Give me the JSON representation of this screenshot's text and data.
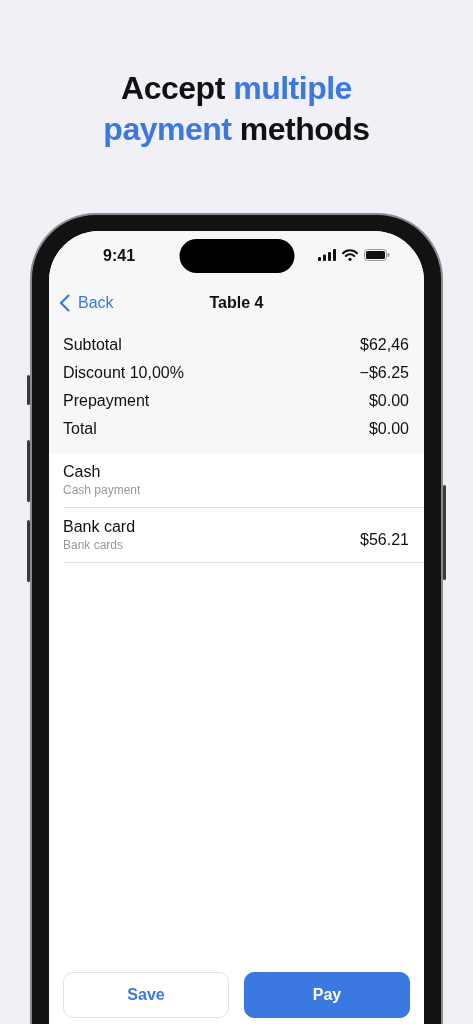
{
  "headline": [
    [
      {
        "text": "Accept",
        "highlight": false
      },
      {
        "text": "multiple",
        "highlight": true
      }
    ],
    [
      {
        "text": "payment",
        "highlight": true
      },
      {
        "text": "methods",
        "highlight": false
      }
    ]
  ],
  "status_bar": {
    "time": "9:41"
  },
  "nav": {
    "back": "Back",
    "title": "Table 4"
  },
  "summary": [
    {
      "label": "Subtotal",
      "value": "$62,46"
    },
    {
      "label": "Discount 10,00%",
      "value": "−$6.25"
    },
    {
      "label": "Prepayment",
      "value": "$0.00"
    },
    {
      "label": "Total",
      "value": "$0.00"
    }
  ],
  "payment_methods": [
    {
      "name": "Cash",
      "description": "Cash payment"
    },
    {
      "name": "Bank card",
      "description": "Bank cards",
      "amount": "$56.21"
    }
  ],
  "buttons": [
    {
      "label": "Save",
      "kind": "secondary"
    },
    {
      "label": "Pay",
      "kind": "primary"
    }
  ]
}
